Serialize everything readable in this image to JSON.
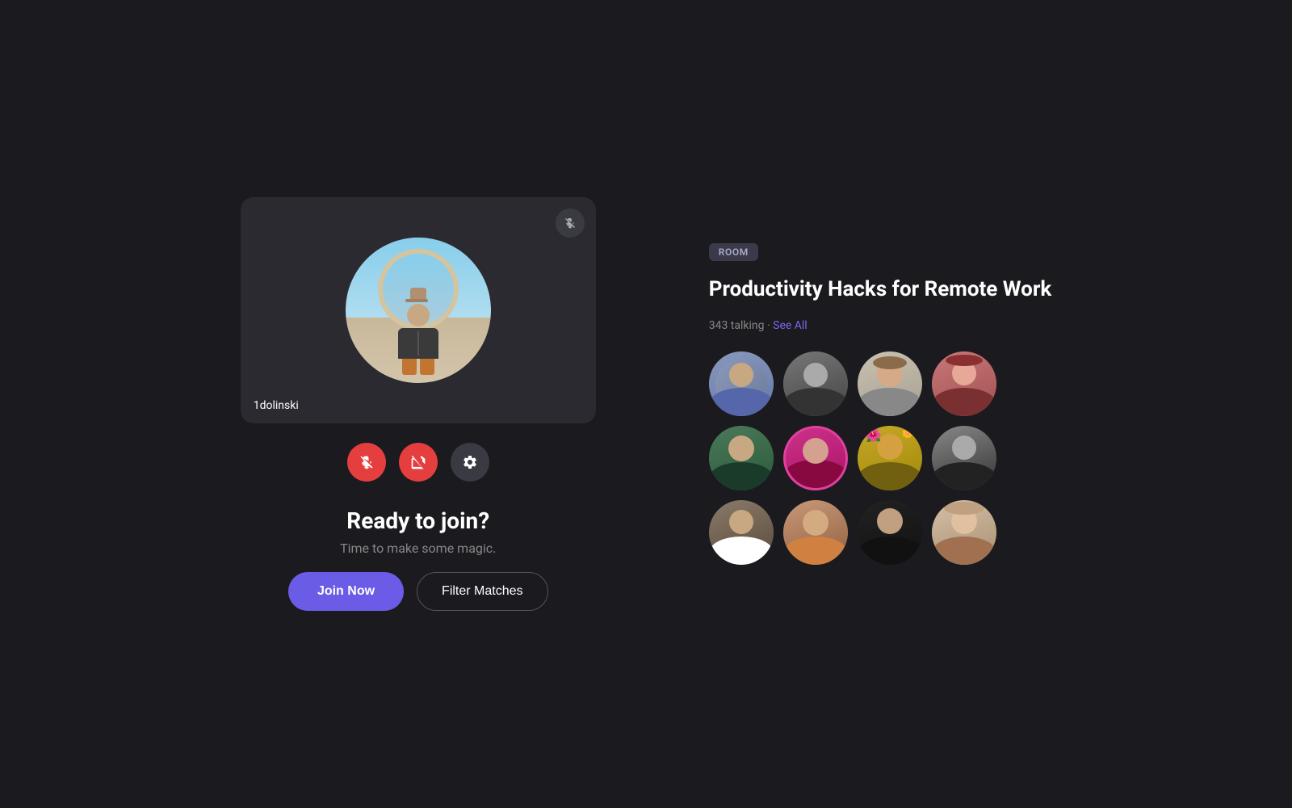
{
  "background_color": "#1a1a1f",
  "left": {
    "video_card": {
      "username": "1dolinski",
      "mute_button_label": "muted"
    },
    "controls": {
      "mic_label": "mic-off",
      "camera_label": "camera-off",
      "settings_label": "settings"
    },
    "cta": {
      "title": "Ready to join?",
      "subtitle": "Time to make some magic.",
      "join_button": "Join Now",
      "filter_button": "Filter Matches"
    }
  },
  "right": {
    "badge": "ROOM",
    "title": "Productivity Hacks for Remote Work",
    "talking_count": "343 talking",
    "see_all_label": "See All",
    "avatars": [
      {
        "id": 1,
        "label": "av1"
      },
      {
        "id": 2,
        "label": "av2"
      },
      {
        "id": 3,
        "label": "av3"
      },
      {
        "id": 4,
        "label": "av4"
      },
      {
        "id": 5,
        "label": "av5"
      },
      {
        "id": 6,
        "label": "av6"
      },
      {
        "id": 7,
        "label": "av7"
      },
      {
        "id": 8,
        "label": "av8"
      },
      {
        "id": 9,
        "label": "av9"
      },
      {
        "id": 10,
        "label": "av10"
      },
      {
        "id": 11,
        "label": "av11"
      },
      {
        "id": 12,
        "label": "av12"
      }
    ]
  }
}
